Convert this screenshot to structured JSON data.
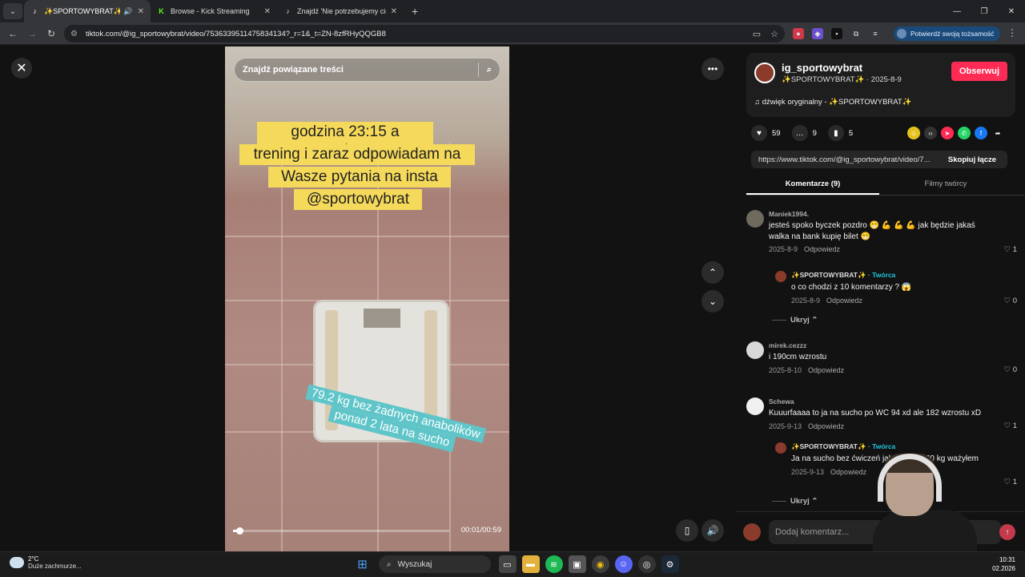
{
  "browser": {
    "tabs": [
      {
        "title": "✨SPORTOWYBRAT✨ (@i",
        "favicon": "tiktok-icon",
        "active": true,
        "audio": true
      },
      {
        "title": "Browse - Kick Streaming",
        "favicon": "kick-icon",
        "active": false
      },
      {
        "title": "Znajdź 'Nie potrzebujemy cię w",
        "favicon": "tiktok-icon",
        "active": false
      }
    ],
    "url": "tiktok.com/@ig_sportowybrat/video/7536339511475834134?_r=1&_t=ZN-8zfRHyQQGB8",
    "verify_label": "Potwierdź swoją tożsamość"
  },
  "video": {
    "search_placeholder": "Znajdź powiązane treści",
    "caption_lines": [
      "godzina 23:15 a sportowy",
      "trening i zaraz odpowiadam na",
      "Wasze pytania na insta",
      "@sportowybrat"
    ],
    "overlay_lines": [
      "79.2 kg bez żadnych anabolików",
      "ponad 2 lata na sucho"
    ],
    "time": "00:01/00:59",
    "progress": 0.03
  },
  "author": {
    "handle": "ig_sportowybrat",
    "display_line": "✨SPORTOWYBRAT✨ · 2025-8-9",
    "follow_label": "Obserwuj",
    "music": "dźwięk oryginalny - ✨SPORTOWYBRAT✨"
  },
  "stats": {
    "likes": "59",
    "comments": "9",
    "saves": "5"
  },
  "share": {
    "link": "https://www.tiktok.com/@ig_sportowybrat/video/7...",
    "copy_label": "Skopiuj łącze"
  },
  "panel_tabs": {
    "comments": "Komentarze (9)",
    "creator_videos": "Filmy twórcy"
  },
  "comments": [
    {
      "user": "Maniek1994.",
      "text": "jesteś spoko byczek pozdro 😁 💪 💪 💪 jak będzie jakaś walka na bank kupię bilet 😁",
      "date": "2025-8-9",
      "reply": "Odpowiedz",
      "likes": "1"
    },
    {
      "user": "✨SPORTOWYBRAT✨",
      "creator_tag": "· Twórca",
      "text": "o co chodzi z 10 komentarzy ? 😱",
      "date": "2025-8-9",
      "reply": "Odpowiedz",
      "likes": "0"
    },
    {
      "user": "mirek.cezzz",
      "text": "i 190cm wzrostu",
      "date": "2025-8-10",
      "reply": "Odpowiedz",
      "likes": "0"
    },
    {
      "user": "Schewa",
      "text": "Kuuurfaaaa to ja na sucho po WC 94 xd ale 182 wzrostu xD",
      "date": "2025-9-13",
      "reply": "Odpowiedz",
      "likes": "1"
    },
    {
      "user": "✨SPORTOWYBRAT✨",
      "creator_tag": "· Twórca",
      "text": "Ja na sucho bez ćwiczeń jak ...łem to 60 kg ważyłem",
      "date": "2025-9-13",
      "reply": "Odpowiedz",
      "likes": "1"
    }
  ],
  "hide_label": "Ukryj",
  "comment_input_placeholder": "Dodaj komentarz...",
  "taskbar": {
    "temp": "2°C",
    "condition": "Duże zachmurze...",
    "search": "Wyszukaj",
    "time": "10:31",
    "date": "02.2026"
  }
}
